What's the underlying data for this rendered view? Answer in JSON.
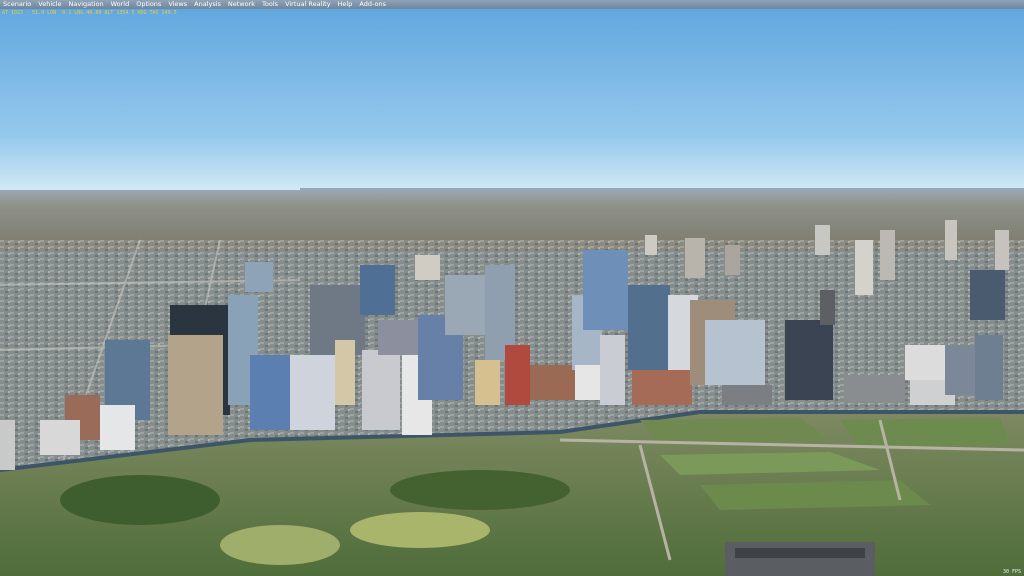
{
  "menu": {
    "items": [
      {
        "label": "Scenario"
      },
      {
        "label": "Vehicle"
      },
      {
        "label": "Navigation"
      },
      {
        "label": "World"
      },
      {
        "label": "Options"
      },
      {
        "label": "Views"
      },
      {
        "label": "Analysis"
      },
      {
        "label": "Network"
      },
      {
        "label": "Tools"
      },
      {
        "label": "Virtual Reality"
      },
      {
        "label": "Help"
      },
      {
        "label": "Add-ons"
      }
    ]
  },
  "overlay": {
    "telemetry": "AT 1023 - 51.9  LON -0.1  LNG 40.80  ALT 1354.5  HDG  TAS 149.5",
    "fps": "30 FPS"
  },
  "colors": {
    "sky_top": "#5ea5de",
    "sky_horizon": "#cfe6f3",
    "menubar": "#7a8fa4",
    "telemetry_text": "#e0d24a"
  },
  "scene": {
    "description_icon": "3d-city-scenery"
  }
}
